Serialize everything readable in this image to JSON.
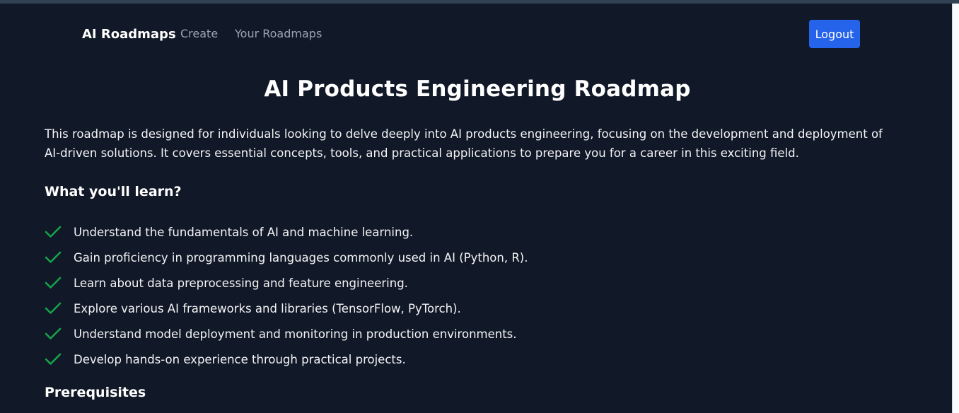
{
  "colors": {
    "background": "#111827",
    "accent": "#2563eb",
    "check": "#16a34a"
  },
  "nav": {
    "brand": "AI Roadmaps",
    "links": [
      "Create",
      "Your Roadmaps"
    ],
    "logout_label": "Logout"
  },
  "page": {
    "title": "AI Products Engineering Roadmap",
    "description": "This roadmap is designed for individuals looking to delve deeply into AI products engineering, focusing on the development and deployment of AI-driven solutions. It covers essential concepts, tools, and practical applications to prepare you for a career in this exciting field."
  },
  "learn": {
    "heading": "What you'll learn?",
    "icon": "check-icon",
    "items": [
      "Understand the fundamentals of AI and machine learning.",
      "Gain proficiency in programming languages commonly used in AI (Python, R).",
      "Learn about data preprocessing and feature engineering.",
      "Explore various AI frameworks and libraries (TensorFlow, PyTorch).",
      "Understand model deployment and monitoring in production environments.",
      "Develop hands-on experience through practical projects."
    ]
  },
  "prerequisites": {
    "heading": "Prerequisites"
  }
}
